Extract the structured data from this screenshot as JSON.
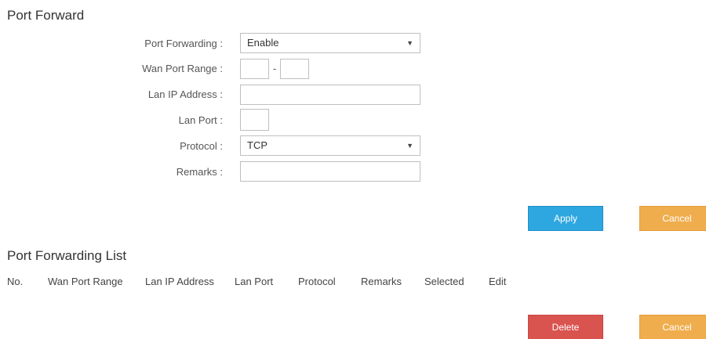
{
  "port_forward": {
    "title": "Port Forward",
    "labels": {
      "port_forwarding": "Port Forwarding :",
      "wan_port_range": "Wan Port Range :",
      "lan_ip_address": "Lan IP Address :",
      "lan_port": "Lan Port :",
      "protocol": "Protocol :",
      "remarks": "Remarks :"
    },
    "values": {
      "port_forwarding": "Enable",
      "wan_port_start": "",
      "wan_port_separator": "-",
      "wan_port_end": "",
      "lan_ip_address": "",
      "lan_port": "",
      "protocol": "TCP",
      "remarks": ""
    },
    "buttons": {
      "apply": "Apply",
      "cancel": "Cancel"
    }
  },
  "port_forwarding_list": {
    "title": "Port Forwarding List",
    "columns": [
      "No.",
      "Wan Port Range",
      "Lan IP Address",
      "Lan Port",
      "Protocol",
      "Remarks",
      "Selected",
      "Edit"
    ],
    "rows": [],
    "buttons": {
      "delete": "Delete",
      "cancel": "Cancel"
    }
  },
  "colors": {
    "apply": "#2ea7e0",
    "cancel": "#f0ad4e",
    "delete": "#d9534f"
  }
}
